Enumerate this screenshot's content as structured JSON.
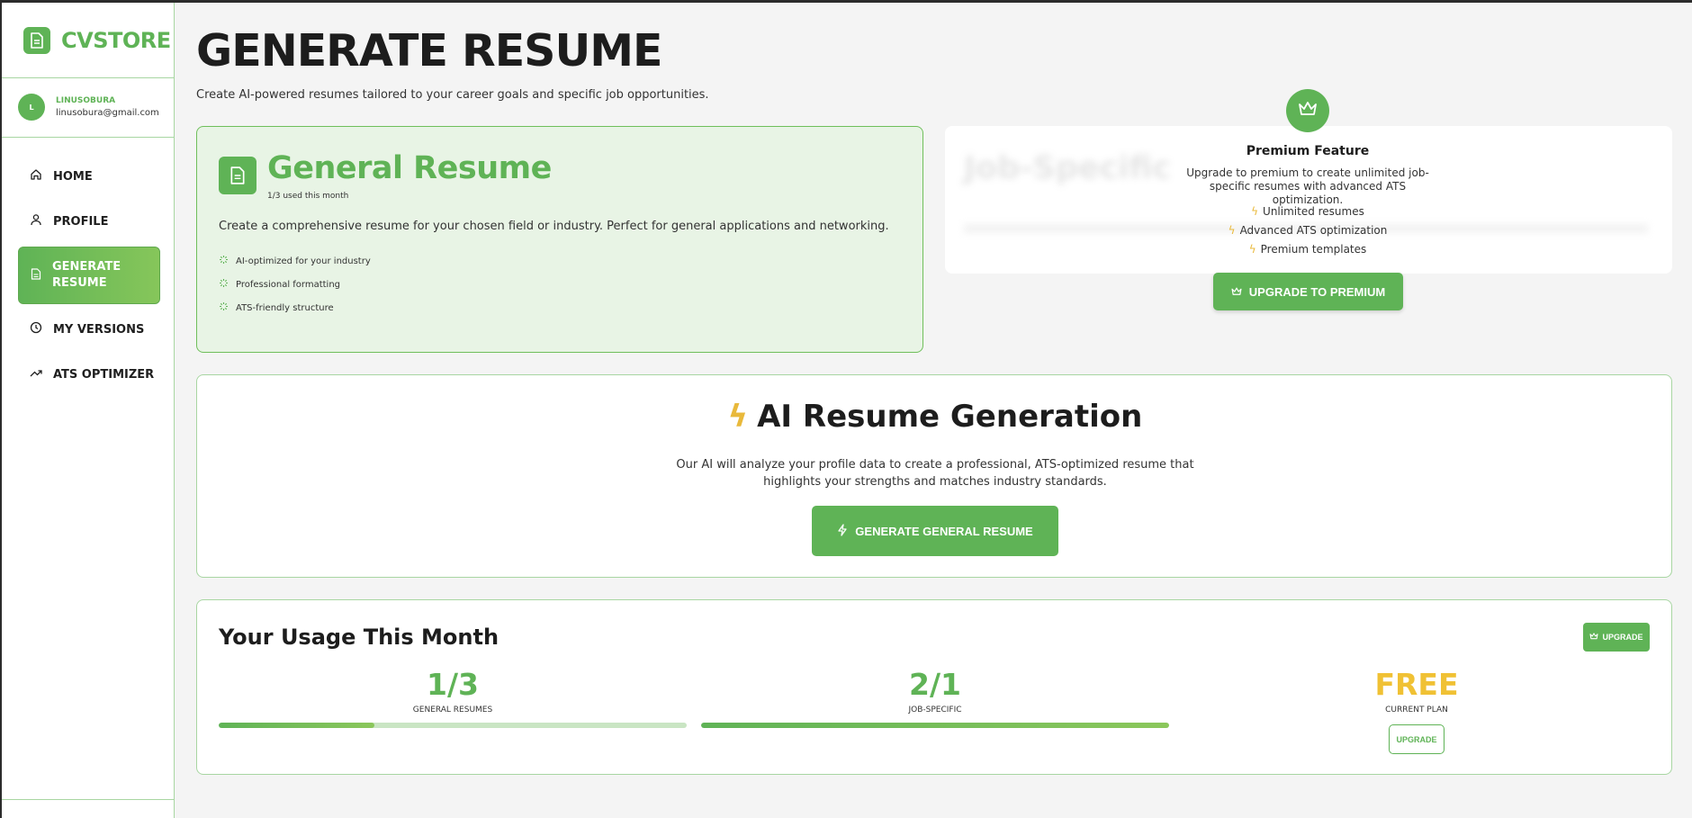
{
  "brand": {
    "name": "CVSTORE",
    "icon": "document-icon",
    "color": "#5fb356"
  },
  "user": {
    "initial": "L",
    "name": "LINUSOBURA",
    "email": "linusobura@gmail.com"
  },
  "nav": [
    {
      "label": "HOME",
      "icon": "home-icon"
    },
    {
      "label": "PROFILE",
      "icon": "user-icon"
    },
    {
      "label": "GENERATE RESUME",
      "icon": "document-icon",
      "active": true
    },
    {
      "label": "MY VERSIONS",
      "icon": "clock-icon"
    },
    {
      "label": "ATS OPTIMIZER",
      "icon": "trending-up-icon"
    }
  ],
  "page": {
    "title": "GENERATE RESUME",
    "subtitle": "Create AI-powered resumes tailored to your career goals and specific job opportunities."
  },
  "general_card": {
    "title": "General Resume",
    "usage": "1/3 used this month",
    "description": "Create a comprehensive resume for your chosen field or industry. Perfect for general applications and networking.",
    "features": [
      "AI-optimized for your industry",
      "Professional formatting",
      "ATS-friendly structure"
    ]
  },
  "job_card": {
    "blurred_title": "Job-Specific"
  },
  "premium": {
    "title": "Premium Feature",
    "description": "Upgrade to premium to create unlimited job-specific resumes with advanced ATS optimization.",
    "features": [
      "Unlimited resumes",
      "Advanced ATS optimization",
      "Premium templates"
    ],
    "button": "UPGRADE TO PREMIUM"
  },
  "ai_section": {
    "title": "AI Resume Generation",
    "description": "Our AI will analyze your profile data to create a professional, ATS-optimized resume that highlights your strengths and matches industry standards.",
    "button": "GENERATE GENERAL RESUME"
  },
  "usage": {
    "title": "Your Usage This Month",
    "upgrade_button": "UPGRADE",
    "stats": [
      {
        "value": "1/3",
        "label": "GENERAL RESUMES",
        "progress": 0.3333
      },
      {
        "value": "2/1",
        "label": "JOB-SPECIFIC",
        "progress": 1.0
      },
      {
        "value": "FREE",
        "label": "CURRENT PLAN"
      }
    ],
    "plan_button": "UPGRADE"
  },
  "colors": {
    "accent": "#5fb356",
    "light_accent": "#e8f4e5",
    "gold": "#e9b93b"
  }
}
